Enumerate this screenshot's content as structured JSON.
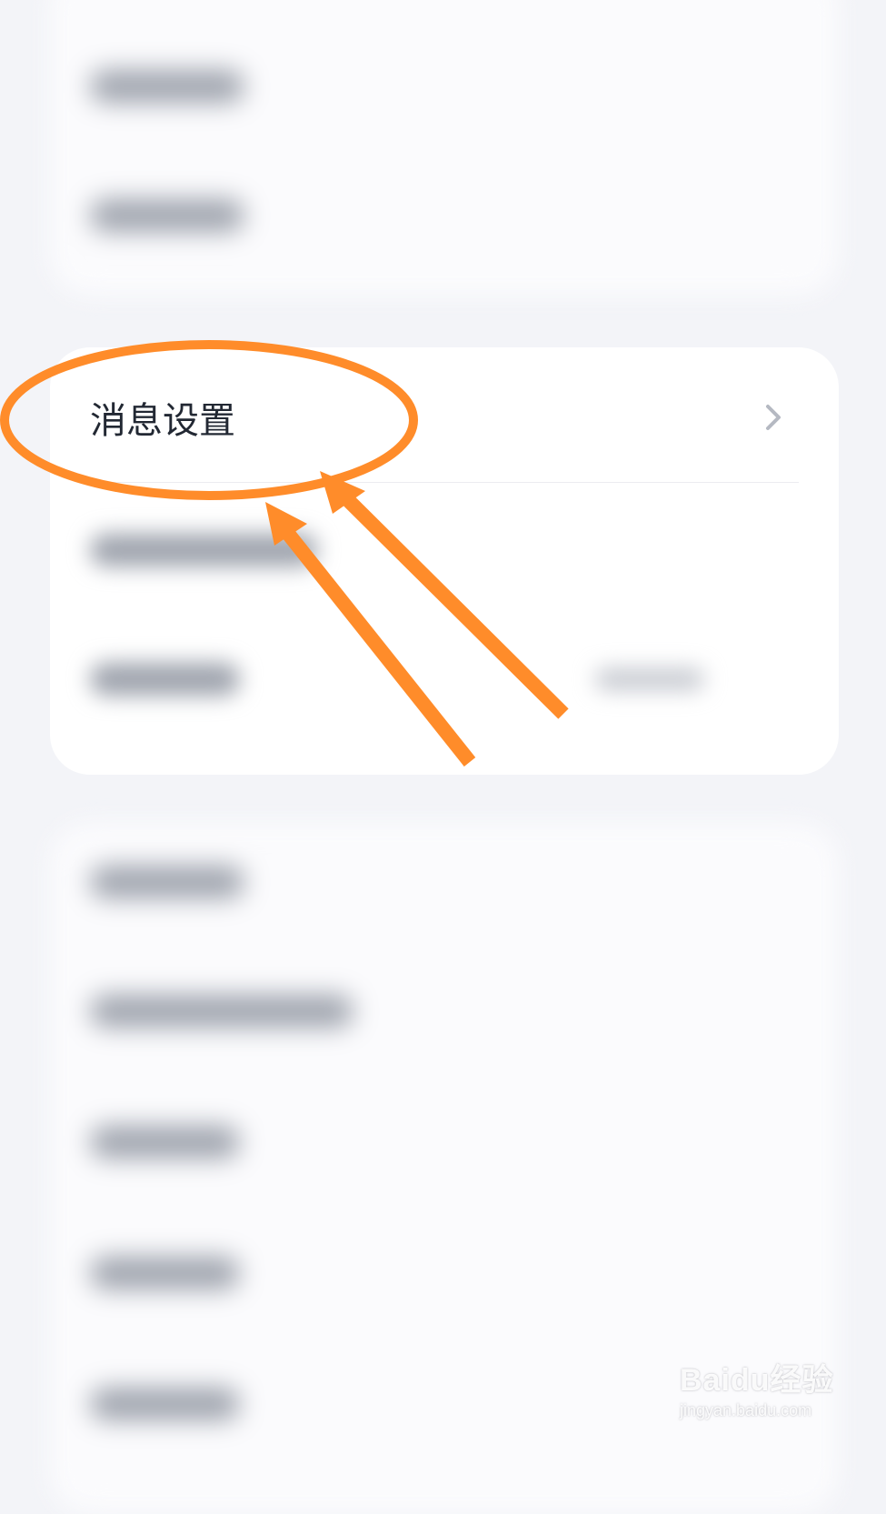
{
  "menu": {
    "message_settings_label": "消息设置"
  },
  "icons": {
    "chevron": "chevron-right-icon"
  },
  "colors": {
    "background": "#f3f4f8",
    "card": "#ffffff",
    "label_text": "#222833",
    "chevron": "#b5b9c2",
    "annotation": "#ff8c2a"
  },
  "watermark": {
    "brand": "Baidu经验",
    "url": "jingyan.baidu.com"
  }
}
